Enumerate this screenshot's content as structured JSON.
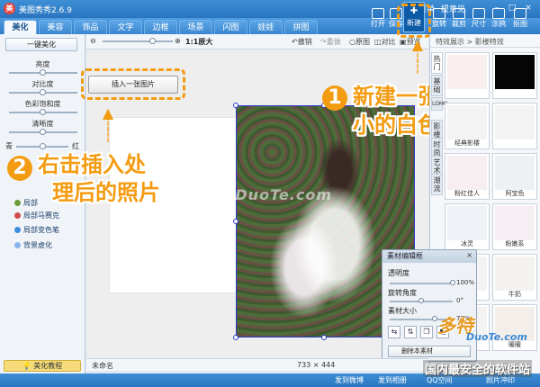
{
  "window": {
    "title": "美图秀秀2.6.9",
    "menu": "菜单",
    "feedback": "提意见"
  },
  "tabs": [
    "美化",
    "美容",
    "饰品",
    "文字",
    "边框",
    "场景",
    "闪图",
    "娃娃",
    "拼图"
  ],
  "toolbar": {
    "new_label": "新建",
    "buttons": [
      "打开",
      "保存",
      "旋转",
      "裁剪",
      "尺寸",
      "涂鸦",
      "抠图"
    ]
  },
  "left_panel": {
    "onekey": "一键美化",
    "sliders": [
      {
        "label": "亮度",
        "value": 0.5
      },
      {
        "label": "对比度",
        "value": 0.5
      },
      {
        "label": "色彩饱和度",
        "value": 0.5
      },
      {
        "label": "清晰度",
        "value": 0.5
      }
    ],
    "color_temp": {
      "left": "青",
      "right": "红",
      "value": 0.5
    },
    "tools": [
      "局部",
      "局部马赛克",
      "局部变色笔",
      "背景虚化"
    ],
    "tutorial": "美化教程"
  },
  "canvas_bar": {
    "zoom": "1:1原大",
    "undo": "撤销",
    "redo": "重做",
    "original": "原图",
    "compare": "对比",
    "preview": "预览"
  },
  "insert_button": "插入一张图片",
  "annotations": {
    "step1_num": "1",
    "step1_line1": "新建一张合适大",
    "step1_line2": "小的白色背景图",
    "step2_num": "2",
    "step2_line1": "右击插入处",
    "step2_line2": "理后的照片"
  },
  "right_panel": {
    "header": "特效展示 > 影楼特效",
    "vtabs": [
      "热门",
      "基础",
      "LOMO",
      "影楼",
      "时尚",
      "艺术",
      "潮流"
    ],
    "thumbs": [
      {
        "caption": "",
        "color": "#f8eeee"
      },
      {
        "caption": "",
        "color": "#050505"
      },
      {
        "caption": "经典影楼",
        "color": "#f3f3f3"
      },
      {
        "caption": "",
        "color": "#f3f3f3"
      },
      {
        "caption": "粉红佳人",
        "color": "#f6eef0"
      },
      {
        "caption": "阿宝色",
        "color": "#eef1f3"
      },
      {
        "caption": "冰灵",
        "color": "#eef2f6"
      },
      {
        "caption": "粉嫩系",
        "color": "#f5eef2"
      },
      {
        "caption": "",
        "color": "#f3f3f3"
      },
      {
        "caption": "牛奶",
        "color": "#f4f2ef"
      },
      {
        "caption": "",
        "color": "#f3f3f3"
      },
      {
        "caption": "暖暖",
        "color": "#f4eeea"
      }
    ]
  },
  "material_editor": {
    "title": "素材编辑框",
    "close": "×",
    "opacity_label": "透明度",
    "opacity_value": "100%",
    "opacity_fraction": 1.0,
    "rotate_label": "旋转角度",
    "rotate_value": "0°",
    "rotate_fraction": 0.5,
    "size_label": "素材大小",
    "size_value": "72%",
    "size_fraction": 0.72,
    "delete_label": "删除本素材"
  },
  "status": {
    "filename": "未命名",
    "dimensions": "733 × 444"
  },
  "bottom_bar": [
    "发到微博",
    "发到相册",
    "QQ空间",
    "照片冲印"
  ],
  "watermarks": {
    "center": "www.DuoTe.com",
    "logo": "多特",
    "sub": "DuoTe.com",
    "banner": "国内最安全的软件站"
  },
  "colors": {
    "accent": "#f39c12",
    "selection": "#2b3cc8",
    "titlebar": "#2a74bf"
  }
}
